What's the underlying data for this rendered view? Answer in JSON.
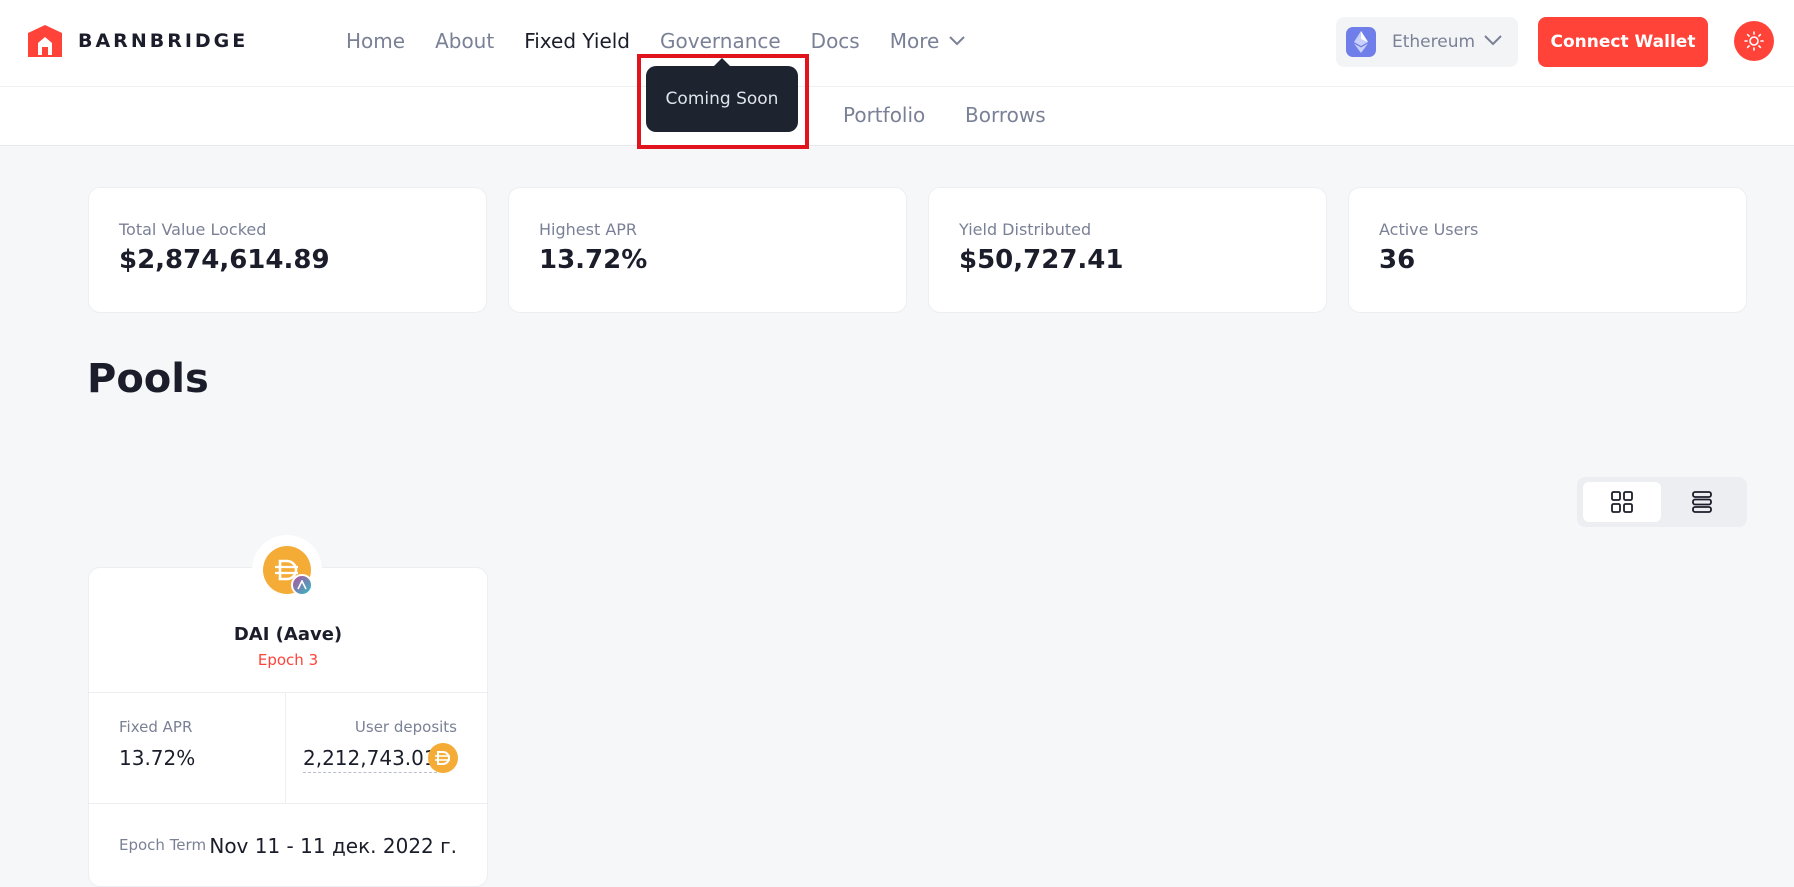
{
  "app": {
    "logo_text": "BARNBRIDGE",
    "brand_color": "#ff4339"
  },
  "nav": {
    "items": [
      "Home",
      "About",
      "Fixed Yield",
      "Governance",
      "Docs"
    ],
    "more_label": "More",
    "active": "Fixed Yield"
  },
  "network": {
    "label": "Ethereum",
    "icon": "ethereum-icon"
  },
  "connect_label": "Connect Wallet",
  "theme_icon": "sun-icon",
  "tooltip": {
    "text": "Coming Soon"
  },
  "subnav": {
    "pools_partial": "s",
    "portfolio": "Portfolio",
    "borrows": "Borrows"
  },
  "stats": [
    {
      "label": "Total Value Locked",
      "value": "$2,874,614.89"
    },
    {
      "label": "Highest APR",
      "value": "13.72%"
    },
    {
      "label": "Yield Distributed",
      "value": "$50,727.41"
    },
    {
      "label": "Active Users",
      "value": "36"
    }
  ],
  "pools_title": "Pools",
  "view_toggle": {
    "grid_icon": "grid-view-icon",
    "list_icon": "list-view-icon",
    "selected": "grid"
  },
  "pool": {
    "name": "DAI (Aave)",
    "epoch": "Epoch 3",
    "fixed_apr_label": "Fixed APR",
    "fixed_apr_value": "13.72%",
    "user_deposits_label": "User deposits",
    "user_deposits_value": "2,212,743.01",
    "epoch_term_label": "Epoch Term",
    "epoch_term_value": "Nov 11 - 11 дек. 2022 г.",
    "token_icon": "dai-icon",
    "protocol_icon": "aave-icon"
  }
}
